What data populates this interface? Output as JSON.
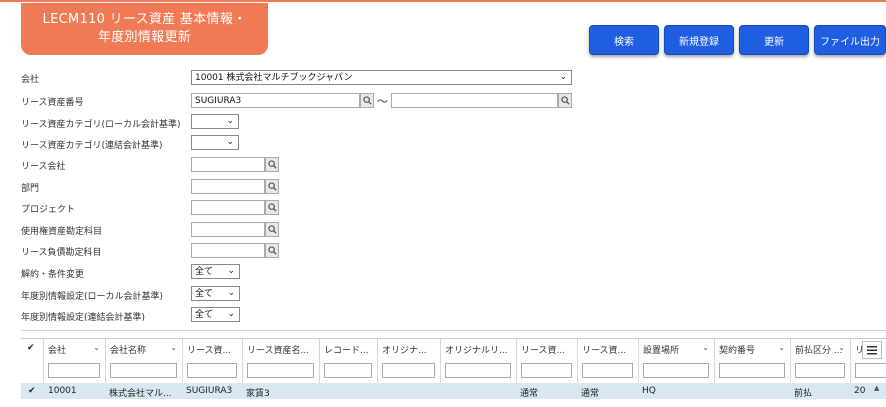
{
  "header": {
    "title_line1": "LECM110 リース資産 基本情報・",
    "title_line2": "年度別情報更新"
  },
  "toolbar": {
    "search_label": "検索",
    "new_label": "新規登録",
    "update_label": "更新",
    "export_label": "ファイル出力"
  },
  "form": {
    "company": {
      "label": "会社",
      "value": "10001 株式会社マルチブックジャパン"
    },
    "asset_no": {
      "label": "リース資産番号",
      "from_value": "SUGIURA3",
      "to_value": "",
      "separator": "〜"
    },
    "category_local": {
      "label": "リース資産カテゴリ(ローカル会計基準)",
      "value": ""
    },
    "category_consol": {
      "label": "リース資産カテゴリ(連結会計基準)",
      "value": ""
    },
    "lease_company": {
      "label": "リース会社",
      "value": ""
    },
    "department": {
      "label": "部門",
      "value": ""
    },
    "project": {
      "label": "プロジェクト",
      "value": ""
    },
    "rou_account": {
      "label": "使用権資産勘定科目",
      "value": ""
    },
    "liability_account": {
      "label": "リース負債勘定科目",
      "value": ""
    },
    "contract_change": {
      "label": "解約・条件変更",
      "value": "全て"
    },
    "yearly_local": {
      "label": "年度別情報設定(ローカル会計基準)",
      "value": "全て"
    },
    "yearly_consol": {
      "label": "年度別情報設定(連結会計基準)",
      "value": "全て"
    }
  },
  "grid": {
    "columns": [
      "会社",
      "会社名称",
      "リース資...",
      "リース資産名...",
      "レコード...",
      "オリジナ...",
      "オリジナルリ...",
      "リース資...",
      "リース資...",
      "設置場所",
      "契約番号",
      "前払区分 ...",
      "リ"
    ],
    "rows": [
      [
        "10001",
        "株式会社マル...",
        "SUGIURA3",
        "家賃3",
        "",
        "",
        "",
        "通常",
        "通常",
        "HQ",
        "",
        "前払",
        "20"
      ]
    ]
  },
  "icons": [
    "search-icon",
    "chevron-down-icon",
    "check-icon",
    "menu-icon"
  ],
  "colors": {
    "accent": "#f07a56",
    "button": "#1e5ee0",
    "selected_row": "#d8e8f3"
  }
}
